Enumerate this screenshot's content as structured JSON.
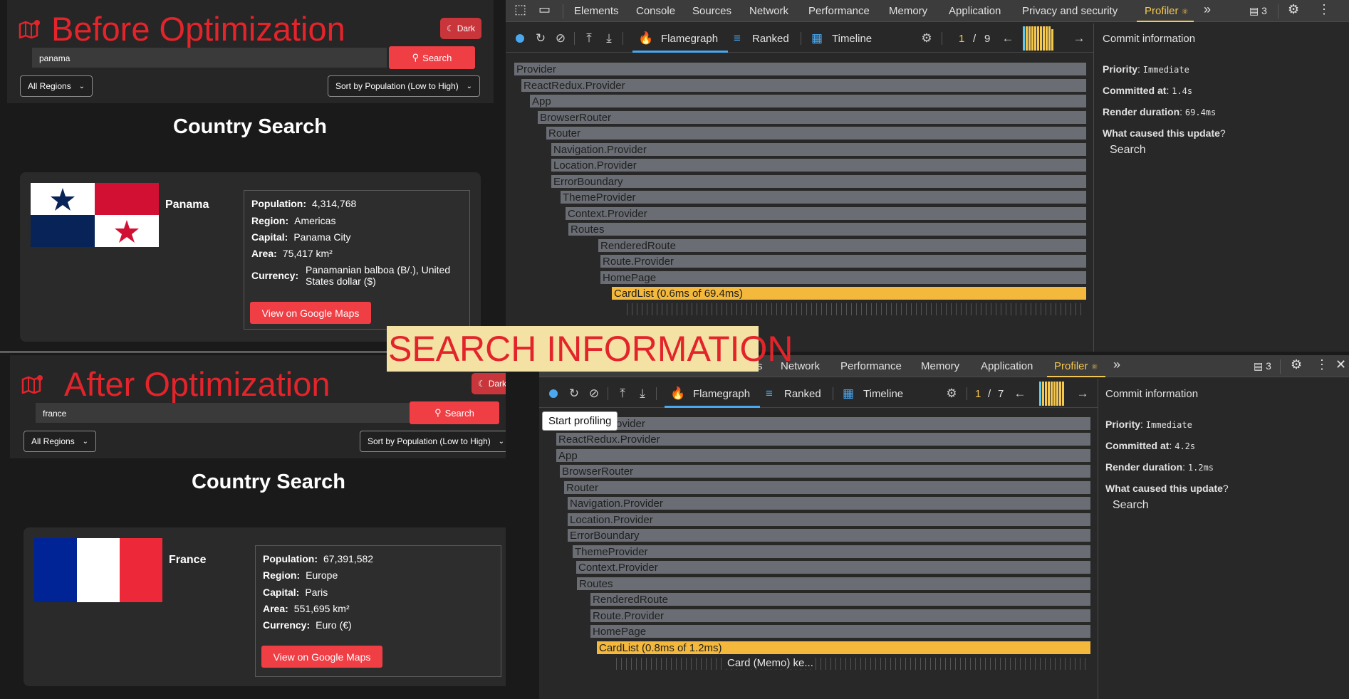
{
  "before": {
    "title": "Before Optimization",
    "dark_label": "Dark",
    "search_value": "panama",
    "search_label": "Search",
    "region_select": "All Regions",
    "sort_select": "Sort by Population (Low to High)",
    "page_title": "Country Search",
    "country": {
      "name": "Panama",
      "population_label": "Population:",
      "population": "4,314,768",
      "region_label": "Region:",
      "region": "Americas",
      "capital_label": "Capital:",
      "capital": "Panama City",
      "area_label": "Area:",
      "area": "75,417 km²",
      "currency_label": "Currency:",
      "currency_line1": "Panamanian balboa (B/.), United",
      "currency_line2": "States dollar ($)",
      "maps_label": "View on Google Maps"
    }
  },
  "after": {
    "title": "After Optimization",
    "dark_label": "Dark",
    "search_value": "france",
    "search_label": "Search",
    "region_select": "All Regions",
    "sort_select": "Sort by Population (Low to High)",
    "page_title": "Country Search",
    "country": {
      "name": "France",
      "population_label": "Population:",
      "population": "67,391,582",
      "region_label": "Region:",
      "region": "Europe",
      "capital_label": "Capital:",
      "capital": "Paris",
      "area_label": "Area:",
      "area": "551,695 km²",
      "currency_label": "Currency:",
      "currency": "Euro (€)",
      "maps_label": "View on Google Maps"
    }
  },
  "caption": "SEARCH INFORMATION",
  "devtools_top": {
    "tabs": [
      "Elements",
      "Console",
      "Sources",
      "Network",
      "Performance",
      "Memory",
      "Application",
      "Privacy and security",
      "Profiler"
    ],
    "badge": "3",
    "view_flamegraph": "Flamegraph",
    "view_ranked": "Ranked",
    "view_timeline": "Timeline",
    "commit_index": "1",
    "commit_sep": "/",
    "commit_total": "9",
    "flame": [
      "Provider",
      "ReactRedux.Provider",
      "App",
      "BrowserRouter",
      "Router",
      "Navigation.Provider",
      "Location.Provider",
      "ErrorBoundary",
      "ThemeProvider",
      "Context.Provider",
      "Routes",
      "RenderedRoute",
      "Route.Provider",
      "HomePage",
      "CardList (0.6ms of 69.4ms)"
    ],
    "commit_info_title": "Commit information",
    "priority_label": "Priority",
    "priority": "Immediate",
    "committed_label": "Committed at",
    "committed": "1.4s",
    "render_label": "Render duration",
    "render": "69.4ms",
    "cause_label": "What caused this update",
    "cause": "Search"
  },
  "devtools_bottom": {
    "tabs": [
      "s",
      "Network",
      "Performance",
      "Memory",
      "Application",
      "Profiler"
    ],
    "badge": "3",
    "view_flamegraph": "Flamegraph",
    "view_ranked": "Ranked",
    "view_timeline": "Timeline",
    "commit_index": "1",
    "commit_sep": "/",
    "commit_total": "7",
    "tooltip": "Start profiling",
    "flame": [
      "Provider",
      "ReactRedux.Provider",
      "App",
      "BrowserRouter",
      "Router",
      "Navigation.Provider",
      "Location.Provider",
      "ErrorBoundary",
      "ThemeProvider",
      "Context.Provider",
      "Routes",
      "RenderedRoute",
      "Route.Provider",
      "HomePage",
      "CardList (0.8ms of 1.2ms)",
      "Card (Memo) ke..."
    ],
    "commit_info_title": "Commit information",
    "priority_label": "Priority",
    "priority": "Immediate",
    "committed_label": "Committed at",
    "committed": "4.2s",
    "render_label": "Render duration",
    "render": "1.2ms",
    "cause_label": "What caused this update",
    "cause": "Search"
  }
}
